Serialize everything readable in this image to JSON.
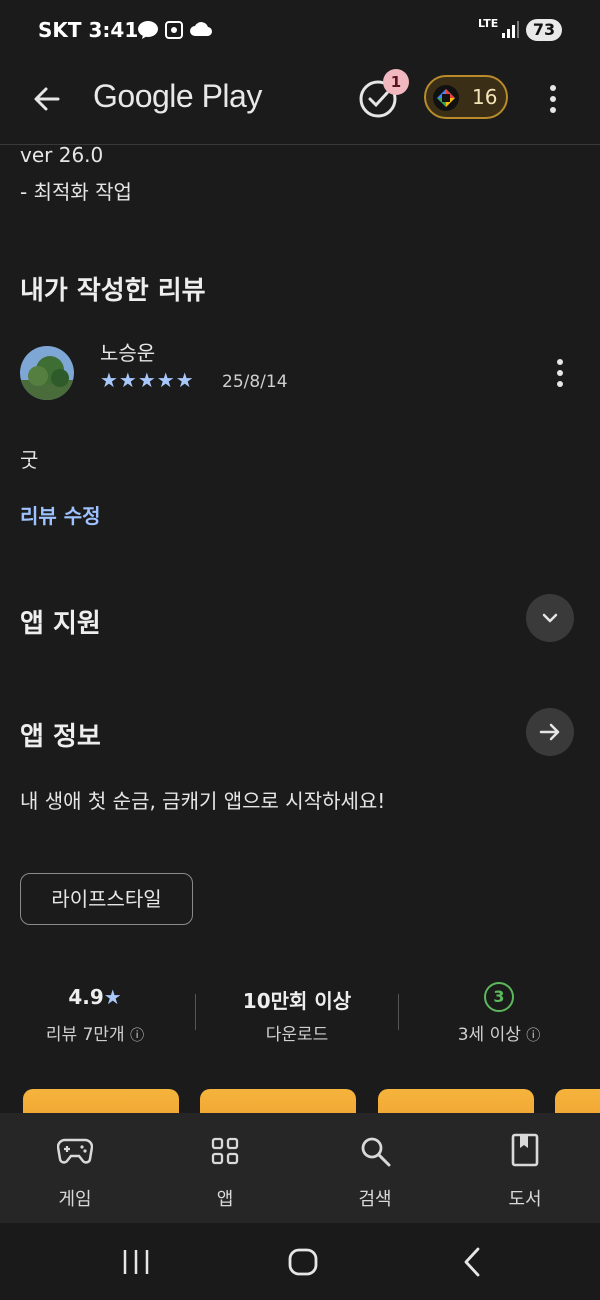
{
  "status_bar": {
    "carrier": "SKT",
    "time": "3:41",
    "network": "LTE",
    "battery": "73"
  },
  "app_bar": {
    "title": "Google Play",
    "notification_count": "1",
    "points": "16"
  },
  "whats_new": {
    "version": "ver 26.0",
    "note": "- 최적화 작업"
  },
  "my_review": {
    "heading": "내가 작성한 리뷰",
    "author": "노승운",
    "stars": 5,
    "date": "25/8/14",
    "body": "굿",
    "edit_label": "리뷰 수정"
  },
  "support": {
    "heading": "앱 지원"
  },
  "about": {
    "heading": "앱 정보",
    "description": "내 생애 첫 순금, 금캐기 앱으로 시작하세요!",
    "category_chip": "라이프스타일"
  },
  "stats": {
    "rating": "4.9",
    "rating_label": "리뷰 7만개",
    "downloads": "10만회 이상",
    "downloads_label": "다운로드",
    "age_badge": "3",
    "age_label": "3세 이상"
  },
  "bottom_nav": {
    "games": "게임",
    "apps": "앱",
    "search": "검색",
    "books": "도서"
  },
  "colors": {
    "accent_link": "#9ec1ff",
    "star": "#a8c7fa",
    "age_green": "#5bb85b",
    "points_gold": "#b98b2a"
  }
}
